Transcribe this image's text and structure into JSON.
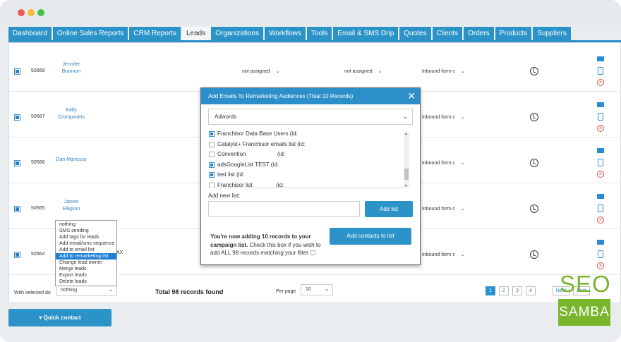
{
  "nav": {
    "tabs": [
      "Dashboard",
      "Online Sales Reports",
      "CRM Reports",
      "Leads",
      "Organizations",
      "Workflows",
      "Tools",
      "Email & SMS Drip",
      "Quotes",
      "Clients",
      "Orders",
      "Products",
      "Suppliers"
    ],
    "active": "Leads"
  },
  "rows": [
    {
      "id": "50568",
      "name1": "Jennifer",
      "name2": "Brannon",
      "assign1": "not assigned",
      "assign2": "not assigned",
      "source": "Inbound form c"
    },
    {
      "id": "50567",
      "name1": "Kelly",
      "name2": "Crompvoets",
      "source": "Inbound form c"
    },
    {
      "id": "50566",
      "name1": "Dan Mancuso",
      "name2": "",
      "source": "Inbound form c"
    },
    {
      "id": "50565",
      "name1": "James",
      "name2": "Elligson",
      "source": "Inbound form c"
    },
    {
      "id": "50564",
      "name1": "",
      "name2": "",
      "extra": "AX",
      "source": "Inbound form c"
    }
  ],
  "footer": {
    "with_selected_label": "With selected do",
    "with_selected_value": "nothing",
    "total": "Total 98 records found",
    "per_page_label": "Per page",
    "per_page_value": "10",
    "pages": [
      "1",
      "2",
      "3",
      "4",
      "...",
      "Next",
      "Last"
    ]
  },
  "context_menu": {
    "items": [
      "nothing",
      "SMS sending",
      "Add tags for leads",
      "Add email/sms sequence",
      "Add to email list",
      "Add to remarketing list",
      "Change lead owner",
      "Merge leads",
      "Export leads",
      "Delete leads"
    ],
    "highlighted": "Add to remarketing list"
  },
  "quick_contact": "Quick contact",
  "modal": {
    "title": "Add Emails To Remarketing Audiences (Total 10 Records)",
    "close": "✕",
    "platform": "Adwords",
    "lists": [
      {
        "label": "Franchisor Data Base Users (id:",
        "checked": true
      },
      {
        "label": "Catalyst+ Franchisor emails list (id:",
        "checked": false
      },
      {
        "label": "Convention                    (id:",
        "checked": false
      },
      {
        "label": "adsGoogleList TEST (id:",
        "checked": true
      },
      {
        "label": "test list (id:",
        "checked": true
      },
      {
        "label": "Franchisor list               (id:",
        "checked": false
      }
    ],
    "new_list_label": "Add new list:",
    "add_list_button": "Add list",
    "info_bold": "You're now adding 10 records to your campaign list.",
    "info_rest": " Check this box if you wish to add ALL 98 records matching your filter",
    "add_contacts_button": "Add contacts to list"
  },
  "watermark": {
    "line1": "SEO",
    "line2": "SAMBA"
  }
}
